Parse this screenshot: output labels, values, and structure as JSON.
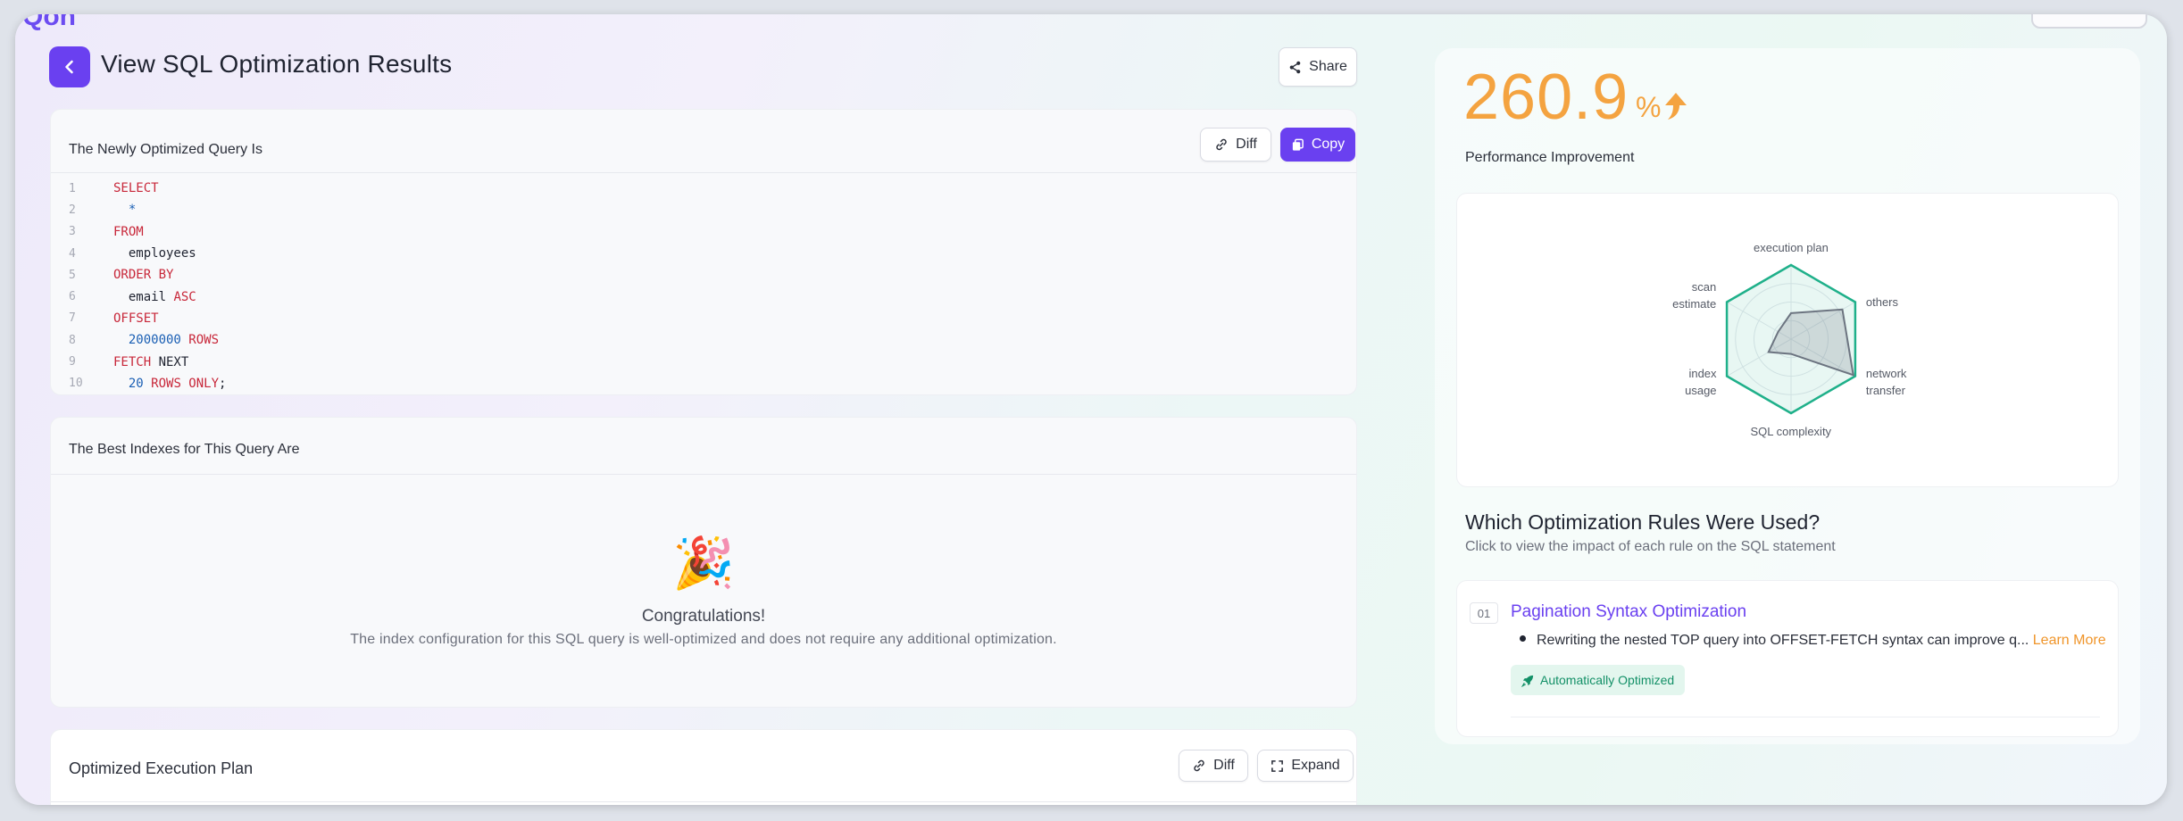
{
  "header": {
    "logo_fragment": "Ԛon",
    "title": "View SQL Optimization Results",
    "share_label": "Share"
  },
  "optimized_query": {
    "title": "The Newly Optimized Query Is",
    "diff_label": "Diff",
    "copy_label": "Copy",
    "lines": [
      {
        "n": "1",
        "tokens": [
          {
            "t": "SELECT",
            "c": "kw"
          }
        ]
      },
      {
        "n": "2",
        "tokens": [
          {
            "t": "  *",
            "c": "op"
          }
        ]
      },
      {
        "n": "3",
        "tokens": [
          {
            "t": "FROM",
            "c": "kw"
          }
        ]
      },
      {
        "n": "4",
        "tokens": [
          {
            "t": "  employees",
            "c": "id"
          }
        ]
      },
      {
        "n": "5",
        "tokens": [
          {
            "t": "ORDER BY",
            "c": "kw"
          }
        ]
      },
      {
        "n": "6",
        "tokens": [
          {
            "t": "  email ",
            "c": "id"
          },
          {
            "t": "ASC",
            "c": "kw"
          }
        ]
      },
      {
        "n": "7",
        "tokens": [
          {
            "t": "OFFSET",
            "c": "kw"
          }
        ]
      },
      {
        "n": "8",
        "tokens": [
          {
            "t": "  2000000 ",
            "c": "num"
          },
          {
            "t": "ROWS",
            "c": "kw"
          }
        ]
      },
      {
        "n": "9",
        "tokens": [
          {
            "t": "FETCH ",
            "c": "kw"
          },
          {
            "t": "NEXT",
            "c": "id"
          }
        ]
      },
      {
        "n": "10",
        "tokens": [
          {
            "t": "  20 ",
            "c": "num"
          },
          {
            "t": "ROWS ONLY",
            "c": "kw"
          },
          {
            "t": ";",
            "c": "id"
          }
        ]
      }
    ]
  },
  "indexes": {
    "title": "The Best Indexes for This Query Are",
    "emoji": "🎉",
    "congrats_title": "Congratulations!",
    "congrats_desc": "The index configuration for this SQL query is well-optimized and does not require any additional optimization."
  },
  "execution_plan": {
    "title": "Optimized Execution Plan",
    "diff_label": "Diff",
    "expand_label": "Expand"
  },
  "performance": {
    "value": "260.9",
    "unit": "%",
    "label": "Performance Improvement",
    "accent_color": "#f4a340"
  },
  "radar": {
    "axes": [
      {
        "label": "execution plan",
        "value": 0.35
      },
      {
        "label": "others",
        "value": 0.8
      },
      {
        "label": "network\ntransfer",
        "value": 0.97
      },
      {
        "label": "SQL complexity",
        "value": 0.2
      },
      {
        "label": "index\nusage",
        "value": 0.35
      },
      {
        "label": "scan\nestimate",
        "value": 0.2
      }
    ],
    "outer_color": "#1fb08a",
    "inner_color": "#6c7480"
  },
  "rules": {
    "title": "Which Optimization Rules Were Used?",
    "subtitle": "Click to view the impact of each rule on the SQL statement",
    "items": [
      {
        "number": "01",
        "name": "Pagination Syntax Optimization",
        "description": "Rewriting the nested TOP query into OFFSET-FETCH syntax can improve q...",
        "learn_more": "Learn More",
        "badge": "Automatically Optimized"
      }
    ]
  }
}
